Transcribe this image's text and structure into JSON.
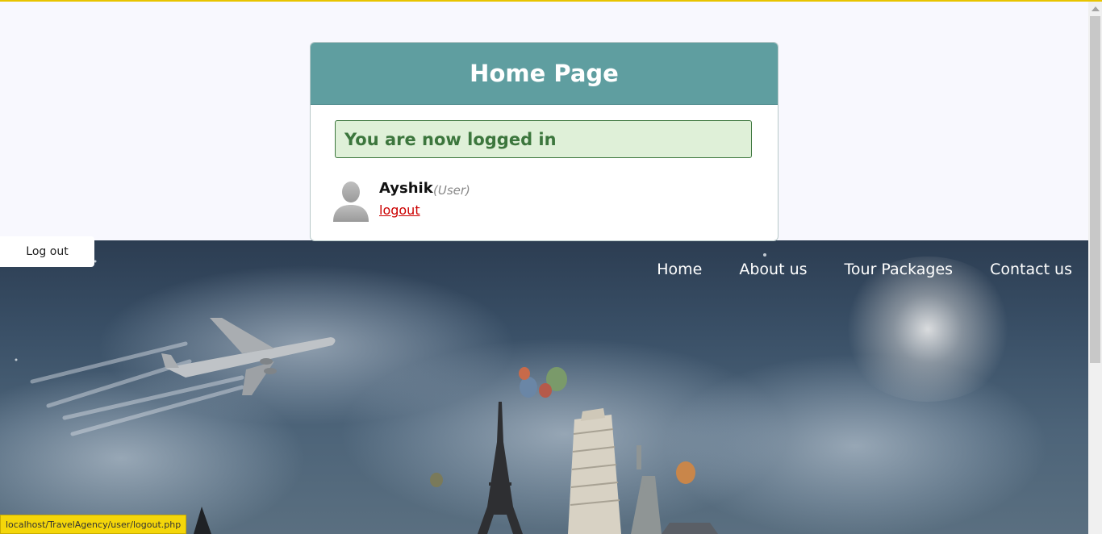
{
  "card": {
    "title": "Home Page",
    "success_message": "You are now logged in",
    "user": {
      "name": "Ayshik",
      "role": "(User)",
      "logout_link": "logout"
    }
  },
  "hero": {
    "nav": [
      "Home",
      "About us",
      "Tour Packages",
      "Contact us"
    ]
  },
  "logout_button": "Log out",
  "status_url": "localhost/TravelAgency/user/logout.php",
  "colors": {
    "header_teal": "#5f9ea0",
    "success_bg": "#dff0d8",
    "success_text": "#3c763d",
    "logout_link": "#cc0000",
    "top_border": "#e8c400"
  },
  "icons": [
    "user-avatar-icon",
    "airplane-icon",
    "eiffel-tower-icon",
    "leaning-tower-icon",
    "statue-of-liberty-icon",
    "hot-air-balloon-icon"
  ]
}
